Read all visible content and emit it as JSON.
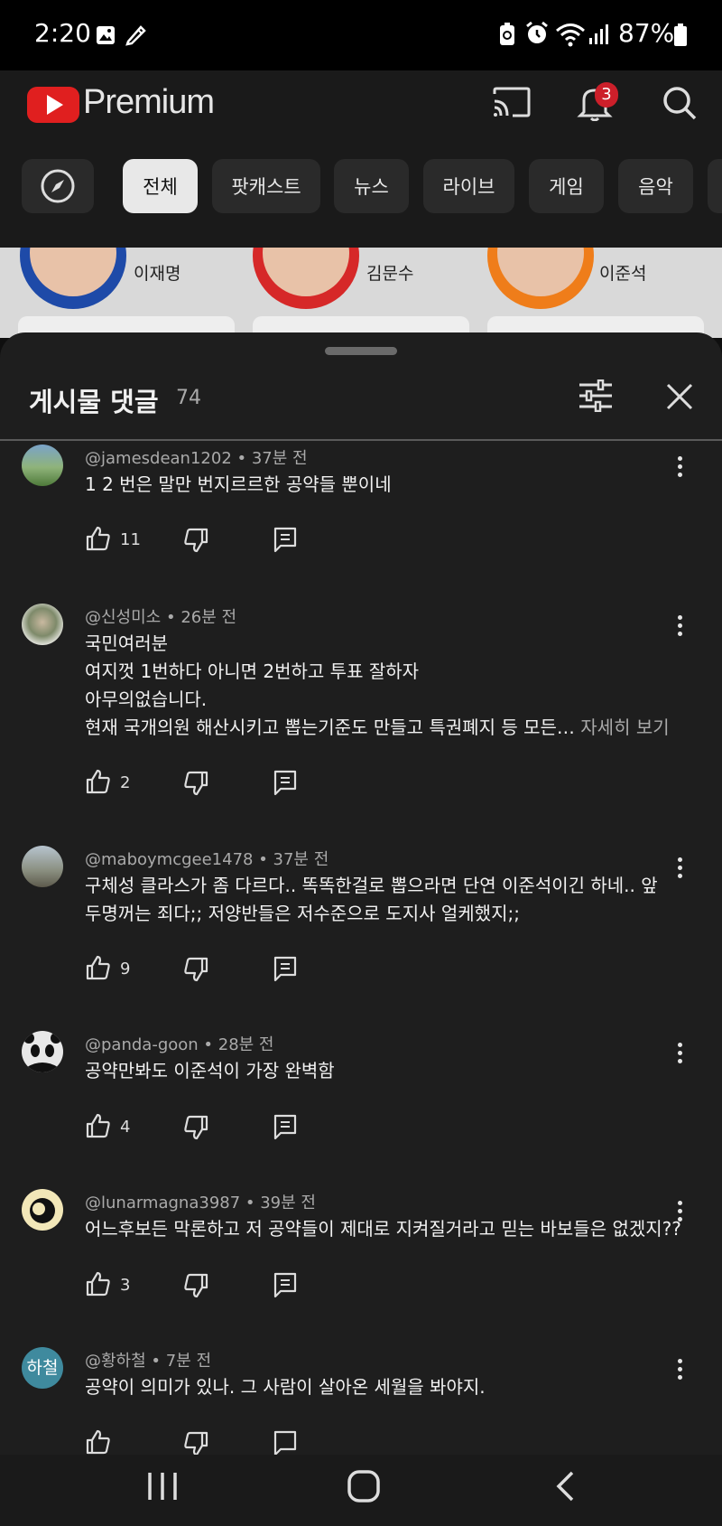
{
  "status_bar": {
    "time": "2:20",
    "battery": "87%"
  },
  "app": {
    "brand": "Premium",
    "notification_count": "3"
  },
  "chips": [
    "전체",
    "팟캐스트",
    "뉴스",
    "라이브",
    "게임",
    "음악"
  ],
  "thumbnail": {
    "names": [
      "이재명",
      "김문수",
      "이준석"
    ]
  },
  "sheet": {
    "title": "게시물 댓글",
    "count": "74"
  },
  "comments": [
    {
      "author": "@jamesdean1202",
      "time": "37분 전",
      "lines": [
        "1 2 번은 말만 번지르르한 공약들 뿐이네"
      ],
      "likes": "11"
    },
    {
      "author": "@신성미소",
      "time": "26분 전",
      "lines": [
        "국민여러분",
        "여지껏 1번하다 아니면 2번하고 투표 잘하자",
        "아무의없습니다.",
        "현재 국개의원 해산시키고 뽑는기준도 만들고 특권폐지 등  모든…"
      ],
      "more": "자세히 보기",
      "likes": "2"
    },
    {
      "author": "@maboymcgee1478",
      "time": "37분 전",
      "lines": [
        "구체성 클라스가 좀 다르다.. 똑똑한걸로 뽑으라면 단연 이준석이긴 하네.. 앞",
        "두명꺼는 죄다;; 저양반들은 저수준으로 도지사 얼케했지;;"
      ],
      "likes": "9"
    },
    {
      "author": "@panda-goon",
      "time": "28분 전",
      "lines": [
        "공약만봐도 이준석이 가장 완벽함"
      ],
      "likes": "4"
    },
    {
      "author": "@lunarmagna3987",
      "time": "39분 전",
      "lines": [
        "어느후보든 막론하고 저 공약들이 제대로 지켜질거라고 믿는 바보들은 없겠지??"
      ],
      "likes": "3"
    },
    {
      "author": "@황하철",
      "time": "7분 전",
      "lines": [
        "공약이 의미가 있나. 그 사람이 살아온 세월을 봐야지."
      ],
      "avatar_text": "하철"
    }
  ],
  "colors": {
    "brand_red": "#e01f1f",
    "sheet_bg": "#1e1e1e",
    "meta_gray": "#aaaaaa"
  }
}
